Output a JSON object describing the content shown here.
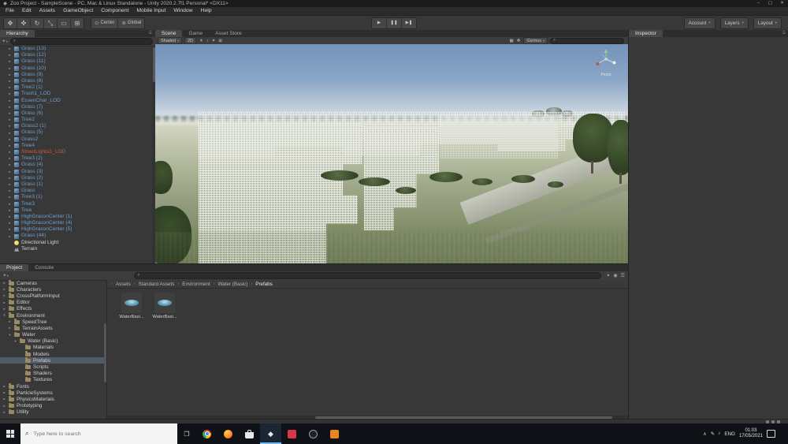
{
  "window": {
    "title": "Zoo Project - SampleScene - PC, Mac & Linux Standalone - Unity 2020.2.7f1 Personal* <DX11>",
    "controls": {
      "minimize": "–",
      "maximize": "▢",
      "close": "✕"
    }
  },
  "menu": {
    "items": [
      "File",
      "Edit",
      "Assets",
      "GameObject",
      "Component",
      "Mobile Input",
      "Window",
      "Help"
    ]
  },
  "toolbar": {
    "tools": [
      {
        "name": "hand-tool",
        "glyph": "✥"
      },
      {
        "name": "move-tool",
        "glyph": "✜"
      },
      {
        "name": "rotate-tool",
        "glyph": "↻"
      },
      {
        "name": "scale-tool",
        "glyph": "⤡"
      },
      {
        "name": "rect-tool",
        "glyph": "▭"
      },
      {
        "name": "transform-tool",
        "glyph": "⊞"
      }
    ],
    "pivot": {
      "icon": "⊙",
      "label": "Center"
    },
    "space": {
      "icon": "⊕",
      "label": "Global"
    },
    "play": {
      "play": "▶",
      "pause": "❚❚",
      "step": "▶❚"
    },
    "account": "Account",
    "layers": "Layers",
    "layout": "Layout"
  },
  "hierarchy": {
    "tab": "Hierarchy",
    "plus": "+",
    "search_glyph": "⌕",
    "menu_icon": "☰",
    "items": [
      {
        "label": "Grass (13)",
        "kind": "prefab",
        "icon": "cube",
        "arrow": "closed"
      },
      {
        "label": "Grass (12)",
        "kind": "prefab",
        "icon": "cube",
        "arrow": "closed"
      },
      {
        "label": "Grass (11)",
        "kind": "prefab",
        "icon": "cube",
        "arrow": "closed"
      },
      {
        "label": "Grass (10)",
        "kind": "prefab",
        "icon": "cube",
        "arrow": "closed"
      },
      {
        "label": "Grass (9)",
        "kind": "prefab",
        "icon": "cube",
        "arrow": "closed"
      },
      {
        "label": "Grass (8)",
        "kind": "prefab",
        "icon": "cube",
        "arrow": "closed"
      },
      {
        "label": "Tree2 (1)",
        "kind": "prefab",
        "icon": "cube",
        "arrow": "closed"
      },
      {
        "label": "Trash1_LOD",
        "kind": "prefab",
        "icon": "cube",
        "arrow": "closed"
      },
      {
        "label": "EssenChar_LOD",
        "kind": "prefab",
        "icon": "cube",
        "arrow": "closed"
      },
      {
        "label": "Grass (7)",
        "kind": "prefab",
        "icon": "cube",
        "arrow": "closed"
      },
      {
        "label": "Grass (6)",
        "kind": "prefab",
        "icon": "cube",
        "arrow": "closed"
      },
      {
        "label": "Tree2",
        "kind": "prefab",
        "icon": "cube",
        "arrow": "closed"
      },
      {
        "label": "Grass2 (1)",
        "kind": "prefab",
        "icon": "cube",
        "arrow": "closed"
      },
      {
        "label": "Grass (5)",
        "kind": "prefab",
        "icon": "cube",
        "arrow": "closed"
      },
      {
        "label": "Grass2",
        "kind": "prefab",
        "icon": "cube",
        "arrow": "closed"
      },
      {
        "label": "Tree4",
        "kind": "prefab",
        "icon": "cube",
        "arrow": "closed"
      },
      {
        "label": "StreetLights3_LOD",
        "kind": "missing",
        "icon": "cube",
        "arrow": "closed"
      },
      {
        "label": "Tree3 (2)",
        "kind": "prefab",
        "icon": "cube",
        "arrow": "closed"
      },
      {
        "label": "Grass (4)",
        "kind": "prefab",
        "icon": "cube",
        "arrow": "closed"
      },
      {
        "label": "Grass (3)",
        "kind": "prefab",
        "icon": "cube",
        "arrow": "closed"
      },
      {
        "label": "Grass (2)",
        "kind": "prefab",
        "icon": "cube",
        "arrow": "closed"
      },
      {
        "label": "Grass (1)",
        "kind": "prefab",
        "icon": "cube",
        "arrow": "closed"
      },
      {
        "label": "Grass",
        "kind": "prefab",
        "icon": "cube",
        "arrow": "closed"
      },
      {
        "label": "Tree3 (1)",
        "kind": "prefab",
        "icon": "cube",
        "arrow": "closed"
      },
      {
        "label": "Tree3",
        "kind": "prefab",
        "icon": "cube",
        "arrow": "closed"
      },
      {
        "label": "Tree",
        "kind": "prefab",
        "icon": "cube",
        "arrow": "closed"
      },
      {
        "label": "HighGrassnCenter (1)",
        "kind": "prefab",
        "icon": "cube",
        "arrow": "closed"
      },
      {
        "label": "HighGrassnCenter (4)",
        "kind": "prefab",
        "icon": "cube",
        "arrow": "closed"
      },
      {
        "label": "HighGrassnCenter (5)",
        "kind": "prefab",
        "icon": "cube",
        "arrow": "closed"
      },
      {
        "label": "Grass (44)",
        "kind": "prefab",
        "icon": "cube",
        "arrow": "closed"
      },
      {
        "label": "Directional Light",
        "kind": "object",
        "icon": "light",
        "arrow": "none"
      },
      {
        "label": "Terrain",
        "kind": "object",
        "icon": "terrain",
        "arrow": "none"
      }
    ]
  },
  "scene_view": {
    "tabs": [
      {
        "name": "tab-scene",
        "label": "Scene",
        "state": "active"
      },
      {
        "name": "tab-game",
        "label": "Game",
        "state": ""
      },
      {
        "name": "tab-asset-store",
        "label": "Asset Store",
        "state": ""
      }
    ],
    "shading": "Shaded",
    "toggle_2d": "2D",
    "left_icons": [
      {
        "name": "light-toggle-icon",
        "glyph": "☀"
      },
      {
        "name": "audio-toggle-icon",
        "glyph": "♪"
      },
      {
        "name": "effects-dropdown-icon",
        "glyph": "✦"
      },
      {
        "name": "grid-dropdown-icon",
        "glyph": "⊞"
      }
    ],
    "right_icons": [
      {
        "name": "snap-settings-icon",
        "glyph": "▦"
      },
      {
        "name": "tool-settings-icon",
        "glyph": "✥"
      }
    ],
    "gizmos": "Gizmos",
    "search_glyph": "⌕",
    "gizmo_label": "Persp"
  },
  "inspector": {
    "tab": "Inspector",
    "menu_icon": "☰"
  },
  "project": {
    "tabs": [
      {
        "name": "tab-project",
        "label": "Project",
        "state": "active"
      },
      {
        "name": "tab-console",
        "label": "Console",
        "state": ""
      }
    ],
    "plus": "+",
    "search_glyph": "⌕",
    "right_icons": [
      {
        "name": "favorites-icon",
        "glyph": "✶"
      },
      {
        "name": "preview-icon",
        "glyph": "◉"
      },
      {
        "name": "panel-menu-icon",
        "glyph": "☰"
      }
    ],
    "breadcrumb": [
      "Assets",
      "Standard Assets",
      "Environment",
      "Water (Basic)",
      "Prefabs"
    ],
    "folders": [
      {
        "label": "Cameras",
        "level": 0,
        "arrow": "closed",
        "state": ""
      },
      {
        "label": "Characters",
        "level": 0,
        "arrow": "closed",
        "state": ""
      },
      {
        "label": "CrossPlatformInput",
        "level": 0,
        "arrow": "closed",
        "state": ""
      },
      {
        "label": "Editor",
        "level": 0,
        "arrow": "closed",
        "state": ""
      },
      {
        "label": "Effects",
        "level": 0,
        "arrow": "closed",
        "state": ""
      },
      {
        "label": "Environment",
        "level": 0,
        "arrow": "open",
        "state": ""
      },
      {
        "label": "SpeedTree",
        "level": 1,
        "arrow": "closed",
        "state": ""
      },
      {
        "label": "TerrainAssets",
        "level": 1,
        "arrow": "closed",
        "state": ""
      },
      {
        "label": "Water",
        "level": 1,
        "arrow": "open",
        "state": ""
      },
      {
        "label": "Water (Basic)",
        "level": 2,
        "arrow": "open",
        "state": ""
      },
      {
        "label": "Materials",
        "level": 3,
        "arrow": "none",
        "state": ""
      },
      {
        "label": "Models",
        "level": 3,
        "arrow": "none",
        "state": ""
      },
      {
        "label": "Prefabs",
        "level": 3,
        "arrow": "none",
        "state": "selected"
      },
      {
        "label": "Scripts",
        "level": 3,
        "arrow": "none",
        "state": ""
      },
      {
        "label": "Shaders",
        "level": 3,
        "arrow": "none",
        "state": ""
      },
      {
        "label": "Textures",
        "level": 3,
        "arrow": "none",
        "state": ""
      },
      {
        "label": "Fonts",
        "level": 0,
        "arrow": "closed",
        "state": ""
      },
      {
        "label": "ParticleSystems",
        "level": 0,
        "arrow": "closed",
        "state": ""
      },
      {
        "label": "PhysicsMaterials",
        "level": 0,
        "arrow": "closed",
        "state": ""
      },
      {
        "label": "Prototyping",
        "level": 0,
        "arrow": "closed",
        "state": ""
      },
      {
        "label": "Utility",
        "level": 0,
        "arrow": "closed",
        "state": ""
      }
    ],
    "assets": [
      {
        "label": "WaterBasi..."
      },
      {
        "label": "WaterBasi..."
      }
    ]
  },
  "taskbar": {
    "search_placeholder": "Type here to search",
    "search_glyph": "⌕",
    "taskview_glyph": "❐",
    "apps": [
      {
        "name": "chrome-icon",
        "cls": "chrome",
        "state": ""
      },
      {
        "name": "firefox-icon",
        "cls": "firefox",
        "state": ""
      },
      {
        "name": "store-icon",
        "cls": "store",
        "state": ""
      },
      {
        "name": "unity-icon",
        "cls": "unity",
        "state": "active"
      },
      {
        "name": "red-app-icon",
        "cls": "app-red",
        "state": ""
      },
      {
        "name": "dark-app-icon",
        "cls": "app-dark",
        "state": ""
      },
      {
        "name": "orange-app-icon",
        "cls": "app-orange",
        "state": ""
      }
    ],
    "tray": {
      "chevron": "∧",
      "icons": [
        {
          "name": "pen-icon",
          "glyph": "✎"
        },
        {
          "name": "volume-icon",
          "glyph": "♪"
        }
      ],
      "lang": "ENG",
      "time": "01:03",
      "date": "17/05/2021"
    }
  },
  "colors": {
    "prefab_blue": "#6d9ece",
    "missing_red": "#cd5747",
    "panel": "#383838",
    "panel_dark": "#2d2d2d",
    "tab_active": "#474747",
    "selection": "#4f5b66",
    "taskbar": "#0e1116",
    "taskbar_active_underline": "#76b9ed"
  }
}
